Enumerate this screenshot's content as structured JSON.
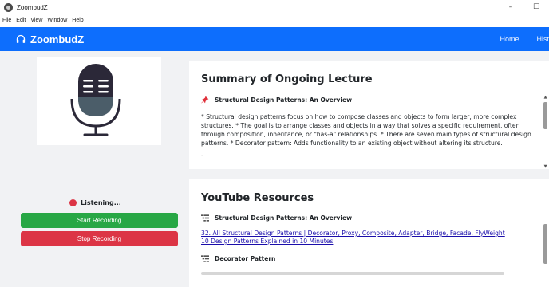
{
  "window": {
    "title": "ZoombudZ",
    "minimize_glyph": "–",
    "maximize_glyph": "☐"
  },
  "menubar": {
    "items": [
      "File",
      "Edit",
      "View",
      "Window",
      "Help"
    ]
  },
  "navbar": {
    "brand": "ZoombudZ",
    "brand_icon": "headphones-icon",
    "links": [
      "Home",
      "Histor"
    ],
    "background": "#0d6efd"
  },
  "recorder": {
    "status_text": "Listening...",
    "status_color": "#dc3545",
    "start_label": "Start Recording",
    "stop_label": "Stop Recording",
    "start_color": "#28a745",
    "stop_color": "#dc3545",
    "mic_icon": "microphone-icon"
  },
  "summary": {
    "title": "Summary of Ongoing Lecture",
    "section_title": "Structural Design Patterns: An Overview",
    "section_icon": "pushpin-icon",
    "text": "* Structural design patterns focus on how to compose classes and objects to form larger, more complex structures. * The goal is to arrange classes and objects in a way that solves a specific requirement, often through composition, inheritance, or \"has-a\" relationships. * There are seven main types of structural design patterns. * Decorator pattern: Adds functionality to an existing object without altering its structure.",
    "trailing": "-"
  },
  "youtube": {
    "title": "YouTube Resources",
    "sections": [
      {
        "title": "Structural Design Patterns: An Overview",
        "links": [
          "32. All Structural Design Patterns | Decorator, Proxy, Composite, Adapter, Bridge, Facade, FlyWeight",
          "10 Design Patterns Explained in 10 Minutes"
        ]
      },
      {
        "title": "Decorator Pattern",
        "links": []
      }
    ],
    "section_icon": "list-icon",
    "link_color": "#1a0dab"
  }
}
